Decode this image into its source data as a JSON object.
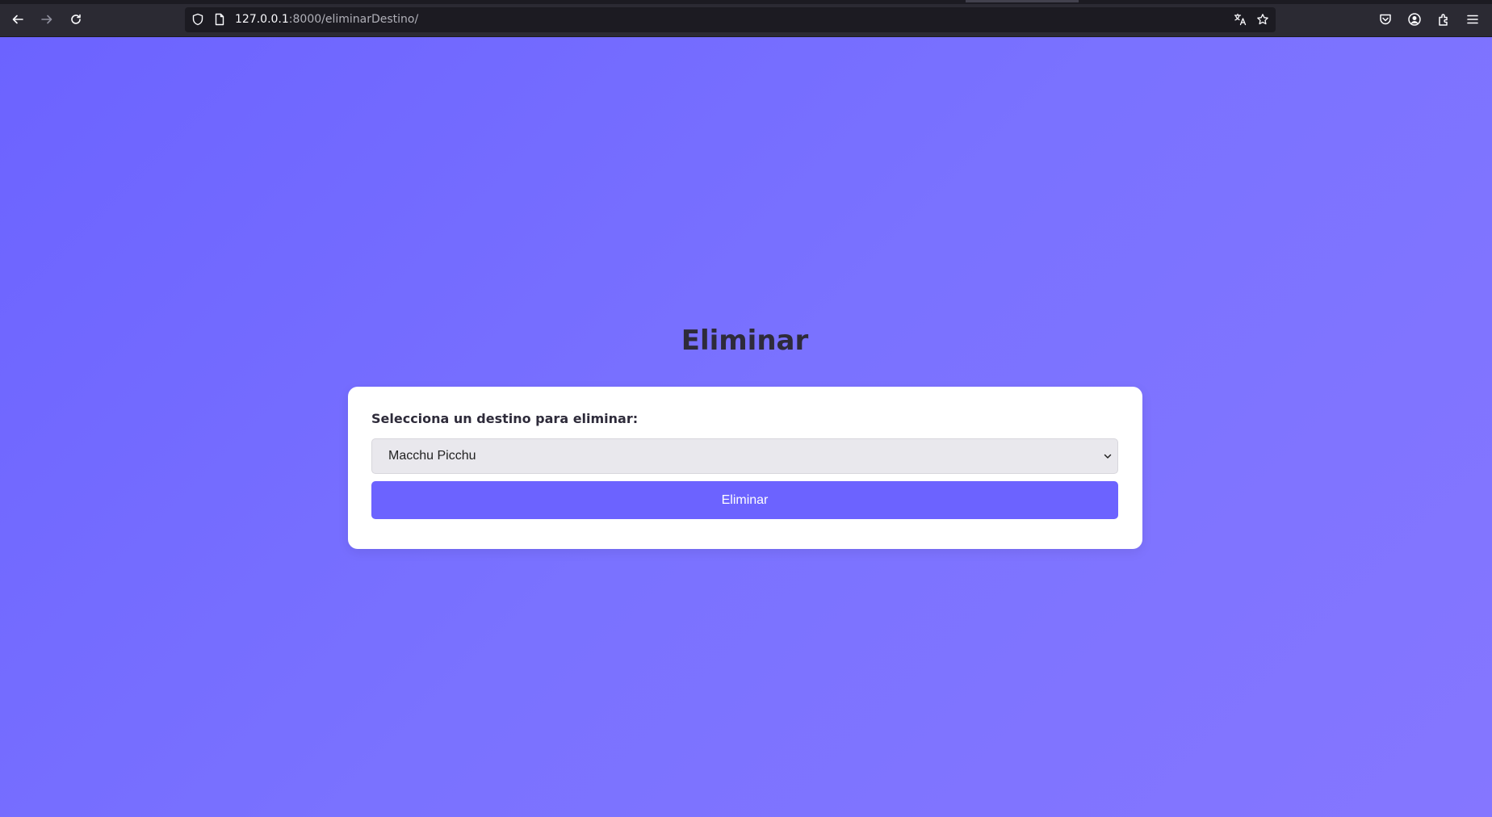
{
  "browser": {
    "url_host": "127.0.0.1",
    "url_rest": ":8000/eliminarDestino/"
  },
  "page": {
    "title": "Eliminar",
    "form": {
      "label": "Selecciona un destino para eliminar:",
      "selected_destination": "Macchu Picchu",
      "submit_label": "Eliminar"
    }
  },
  "colors": {
    "accent": "#6c63ff",
    "background_start": "#6c63ff",
    "background_end": "#8576ff",
    "card": "#ffffff",
    "heading": "#2e2b3a"
  }
}
